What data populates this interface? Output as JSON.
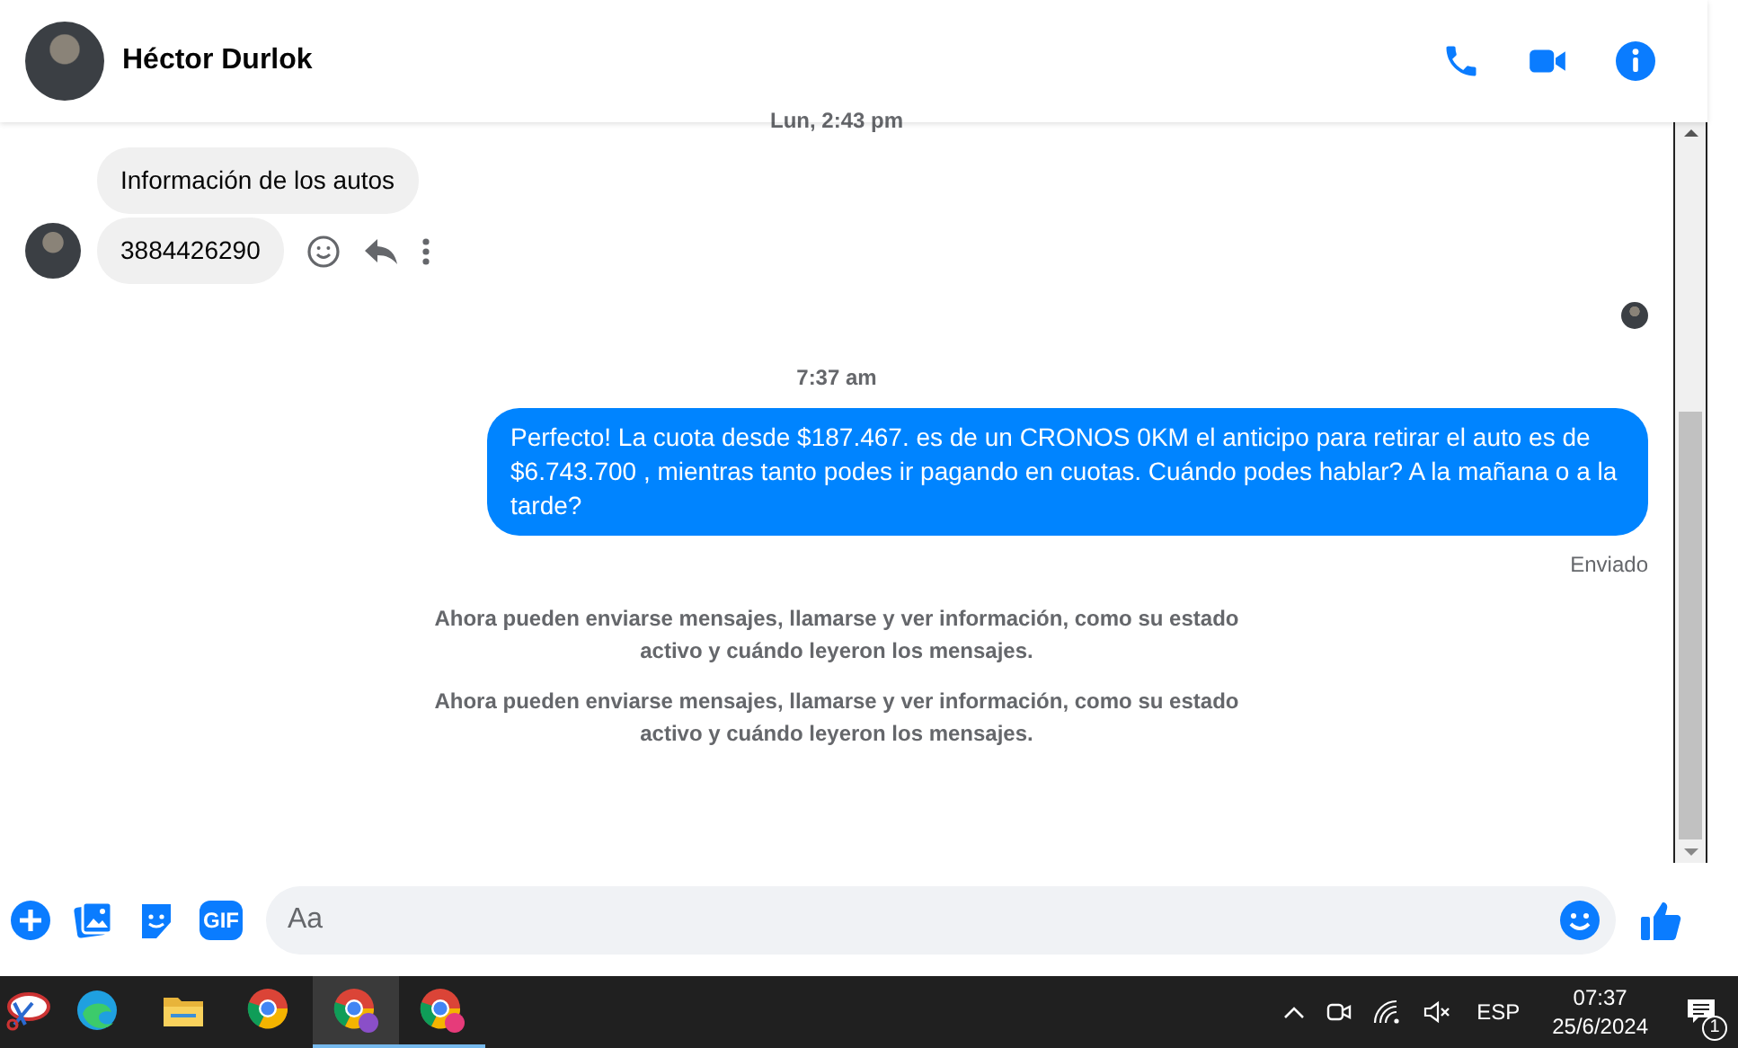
{
  "header": {
    "name": "Héctor Durlok"
  },
  "conversation": [
    {
      "kind": "timestamp",
      "text": "Lun, 2:43 pm"
    },
    {
      "kind": "received",
      "messages": [
        "Información de los autos",
        "3884426290"
      ]
    },
    {
      "kind": "seen"
    },
    {
      "kind": "timestamp",
      "text": "7:37 am"
    },
    {
      "kind": "sent",
      "text": "Perfecto! La cuota desde $187.467. es de un CRONOS 0KM el anticipo para retirar el auto es de $6.743.700 , mientras tanto podes ir pagando en cuotas. Cuándo podes hablar? A la mañana o a la tarde?",
      "status": "Enviado"
    },
    {
      "kind": "notice",
      "text": "Ahora pueden enviarse mensajes, llamarse y ver información, como su estado activo y cuándo leyeron los mensajes."
    },
    {
      "kind": "notice",
      "text": "Ahora pueden enviarse mensajes, llamarse y ver información, como su estado activo y cuándo leyeron los mensajes."
    }
  ],
  "composer": {
    "placeholder": "Aa",
    "gif_label": "GIF"
  },
  "taskbar": {
    "apps": [
      {
        "kind": "snip",
        "selected": false,
        "running": false
      },
      {
        "kind": "edge",
        "selected": false,
        "running": false
      },
      {
        "kind": "folder",
        "selected": false,
        "running": false
      },
      {
        "kind": "chrome",
        "selected": false,
        "running": false
      },
      {
        "kind": "chrome-profile",
        "selected": true,
        "running": true
      },
      {
        "kind": "chrome-c",
        "selected": false,
        "running": true
      }
    ],
    "language": "ESP",
    "time": "07:37",
    "date": "25/6/2024",
    "notifications": "1"
  }
}
